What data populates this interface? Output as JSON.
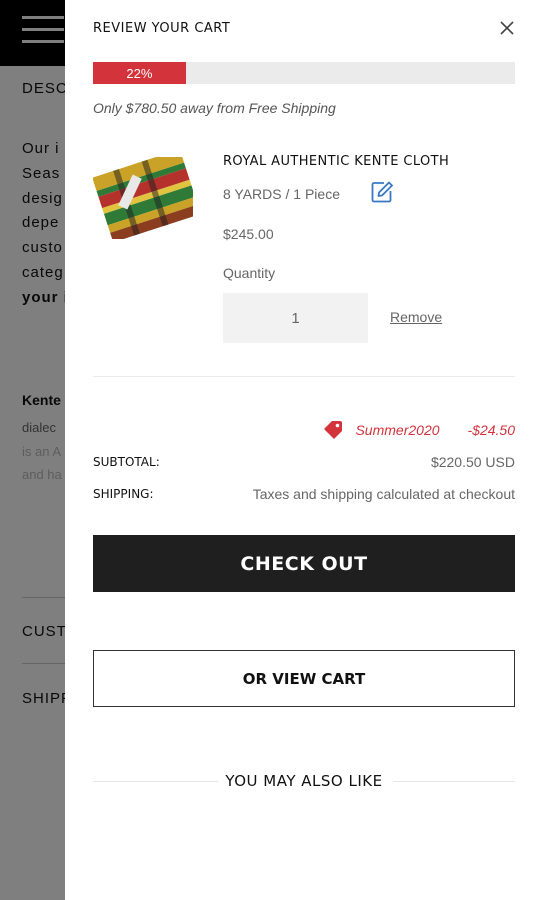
{
  "background": {
    "section_description": "DESC",
    "paragraph_lines": [
      "Our i",
      "Seas",
      "desig",
      "depe",
      "custo",
      "categ",
      "your i"
    ],
    "kente_heading": "Kente",
    "kente_line": "dialec",
    "faded_lines": [
      "is an A",
      "and ha"
    ],
    "section_customs": "CUSTO",
    "section_shipping": "SHIPP"
  },
  "cart": {
    "title": "REVIEW YOUR CART",
    "progress": {
      "percent": 22,
      "label": "22%"
    },
    "shipping_note": "Only $780.50 away from Free Shipping",
    "item": {
      "title": "ROYAL AUTHENTIC KENTE CLOTH",
      "variant": "8 YARDS / 1 Piece",
      "price": "$245.00",
      "quantity_label": "Quantity",
      "quantity": "1",
      "remove_label": "Remove",
      "image_icon": "kente-cloth-thumbnail"
    },
    "discount": {
      "code": "Summer2020",
      "amount": "-$24.50",
      "icon": "tag-icon"
    },
    "subtotal": {
      "label": "SUBTOTAL:",
      "value": "$220.50 USD"
    },
    "shipping": {
      "label": "SHIPPING:",
      "value": "Taxes and shipping calculated at checkout"
    },
    "checkout_label": "CHECK OUT",
    "view_cart_label": "OR VIEW CART",
    "also_like": "YOU MAY ALSO LIKE"
  },
  "colors": {
    "accent": "#d3333b",
    "dark_button": "#1f1f1f",
    "edit_icon": "#3a78c4"
  }
}
